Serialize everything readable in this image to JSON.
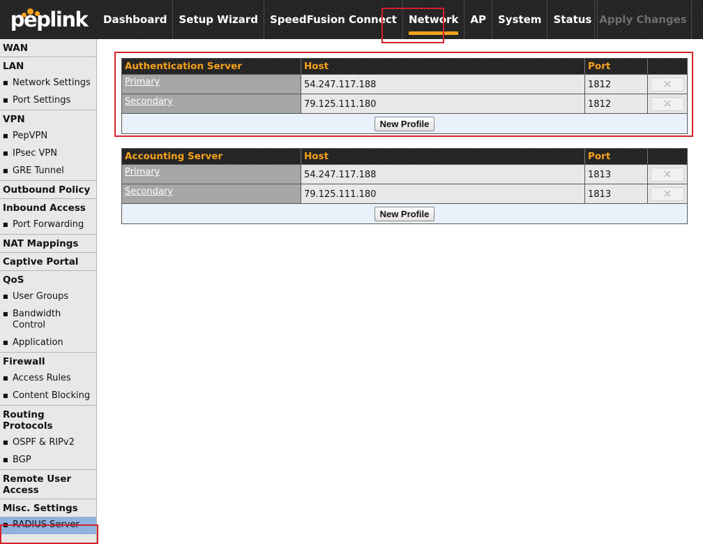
{
  "brand": {
    "name": "peplink",
    "accent": "#f7a21b"
  },
  "nav": {
    "items": [
      "Dashboard",
      "Setup Wizard",
      "SpeedFusion Connect",
      "Network",
      "AP",
      "System",
      "Status"
    ],
    "active": "Network",
    "apply_label": "Apply Changes"
  },
  "sidebar": {
    "wan": "WAN",
    "lan": "LAN",
    "lan_items": [
      "Network Settings",
      "Port Settings"
    ],
    "vpn": "VPN",
    "vpn_items": [
      "PepVPN",
      "IPsec VPN",
      "GRE Tunnel"
    ],
    "outbound": "Outbound Policy",
    "inbound": "Inbound Access",
    "inbound_items": [
      "Port Forwarding"
    ],
    "nat": "NAT Mappings",
    "captive": "Captive Portal",
    "qos": "QoS",
    "qos_items": [
      "User Groups",
      "Bandwidth Control",
      "Application"
    ],
    "firewall": "Firewall",
    "firewall_items": [
      "Access Rules",
      "Content Blocking"
    ],
    "routing": "Routing Protocols",
    "routing_items": [
      "OSPF & RIPv2",
      "BGP"
    ],
    "remote": "Remote User Access",
    "misc": "Misc. Settings",
    "misc_items": [
      "RADIUS Server"
    ],
    "selected": "RADIUS Server"
  },
  "auth_table": {
    "headers": [
      "Authentication Server",
      "Host",
      "Port"
    ],
    "rows": [
      {
        "name": "Primary",
        "host": "54.247.117.188",
        "port": "1812"
      },
      {
        "name": "Secondary",
        "host": "79.125.111.180",
        "port": "1812"
      }
    ],
    "button": "New Profile"
  },
  "acct_table": {
    "headers": [
      "Accounting Server",
      "Host",
      "Port"
    ],
    "rows": [
      {
        "name": "Primary",
        "host": "54.247.117.188",
        "port": "1813"
      },
      {
        "name": "Secondary",
        "host": "79.125.111.180",
        "port": "1813"
      }
    ],
    "button": "New Profile"
  },
  "icons": {
    "delete": "close-icon",
    "bullet": "square-bullet-icon"
  },
  "colors": {
    "highlight": "#d6202a",
    "selected": "#8fb2de"
  }
}
